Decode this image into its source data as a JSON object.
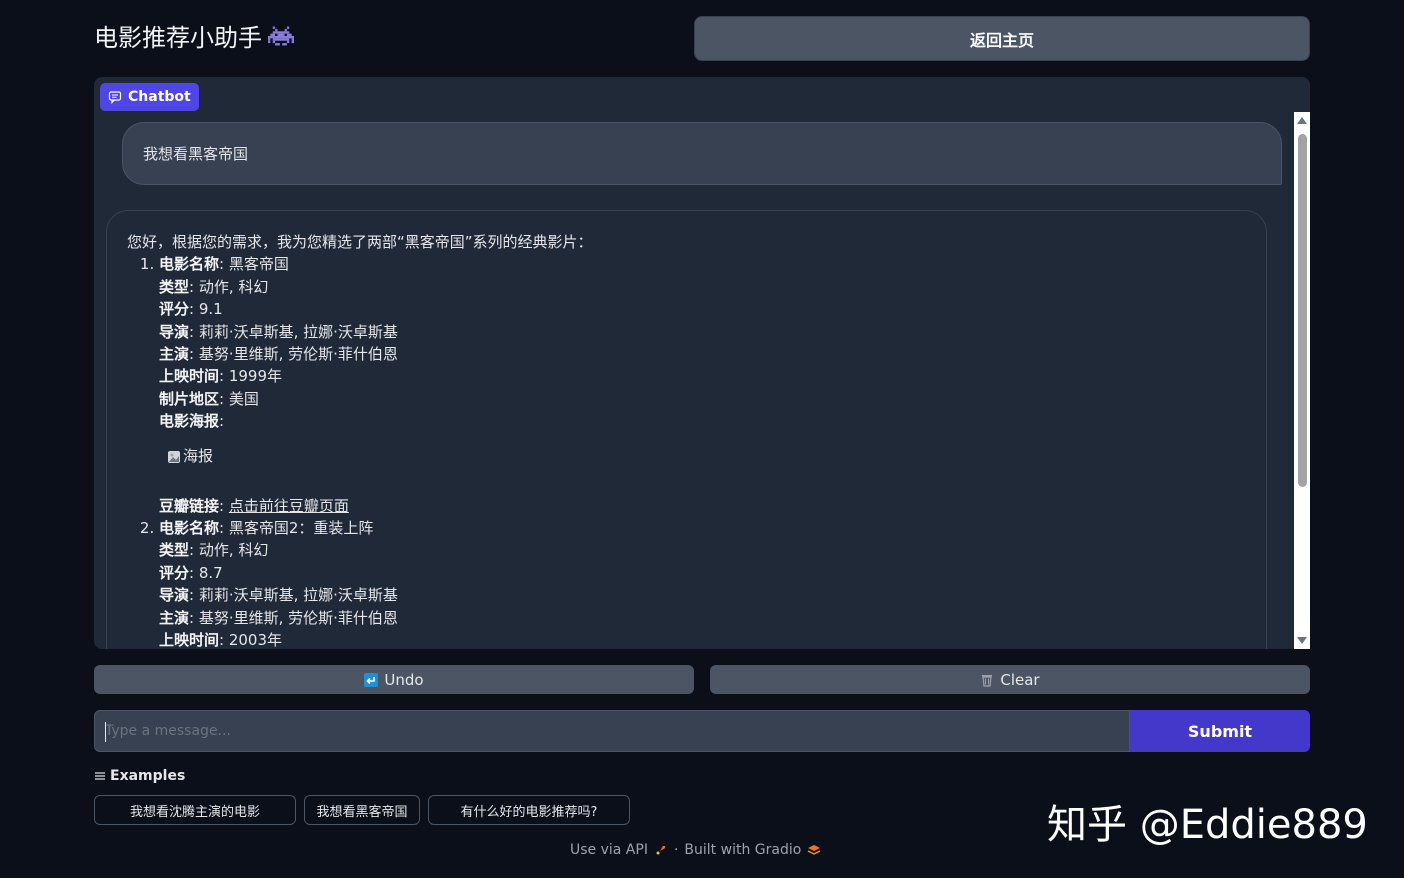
{
  "header": {
    "title": "电影推荐小助手",
    "home_button": "返回主页"
  },
  "chatbot": {
    "label": "Chatbot",
    "user_message": "我想看黑客帝国",
    "bot_intro": "您好，根据您的需求，我为您精选了两部“黑客帝国”系列的经典影片：",
    "movies": [
      {
        "name_label": "电影名称",
        "name": ": 黑客帝国",
        "genre_label": "类型",
        "genre": ": 动作, 科幻",
        "rating_label": "评分",
        "rating": ": 9.1",
        "director_label": "导演",
        "director": ": 莉莉·沃卓斯基, 拉娜·沃卓斯基",
        "cast_label": "主演",
        "cast": ": 基努·里维斯, 劳伦斯·菲什伯恩",
        "release_label": "上映时间",
        "release": ": 1999年",
        "region_label": "制片地区",
        "region": ": 美国",
        "poster_label": "电影海报",
        "poster_colon": ":",
        "poster_alt": "海报",
        "link_label": "豆瓣链接",
        "link_colon": ": ",
        "link_text": "点击前往豆瓣页面"
      },
      {
        "name_label": "电影名称",
        "name": ": 黑客帝国2：重装上阵",
        "genre_label": "类型",
        "genre": ": 动作, 科幻",
        "rating_label": "评分",
        "rating": ": 8.7",
        "director_label": "导演",
        "director": ": 莉莉·沃卓斯基, 拉娜·沃卓斯基",
        "cast_label": "主演",
        "cast": ": 基努·里维斯, 劳伦斯·菲什伯恩",
        "release_label": "上映时间",
        "release": ": 2003年"
      }
    ]
  },
  "actions": {
    "undo": "Undo",
    "clear": "Clear"
  },
  "input": {
    "placeholder": "Type a message...",
    "submit": "Submit"
  },
  "examples": {
    "label": "Examples",
    "items": [
      "我想看沈腾主演的电影",
      "我想看黑客帝国",
      "有什么好的电影推荐吗?"
    ]
  },
  "footer": {
    "api": "Use via API",
    "separator": "·",
    "built": "Built with Gradio"
  },
  "watermark": "知乎 @Eddie889",
  "colors": {
    "accent": "#4f46e5",
    "submit": "#4338ca",
    "background": "#0b0f19",
    "panel": "#1f2937"
  }
}
